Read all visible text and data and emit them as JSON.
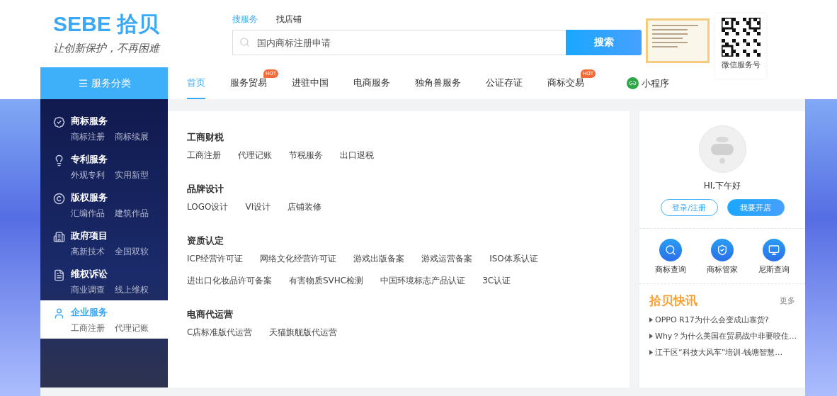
{
  "logo": {
    "brand": "SEBE 拾贝",
    "slogan": "让创新保护，不再困难"
  },
  "search": {
    "tabs": [
      {
        "label": "搜服务",
        "selected": true
      },
      {
        "label": "找店铺",
        "selected": false
      }
    ],
    "placeholder": "国内商标注册申请",
    "button": "搜索"
  },
  "qr": {
    "caption": "微信服务号"
  },
  "category_button": "服务分类",
  "nav": [
    {
      "label": "首页",
      "selected": true
    },
    {
      "label": "服务贸易",
      "selected": false,
      "badge": "HOT"
    },
    {
      "label": "进驻中国",
      "selected": false
    },
    {
      "label": "电商服务",
      "selected": false
    },
    {
      "label": "独角兽服务",
      "selected": false
    },
    {
      "label": "公证存证",
      "selected": false
    },
    {
      "label": "商标交易",
      "selected": false,
      "badge": "HOT"
    }
  ],
  "mini_program": "小程序",
  "sidebar": [
    {
      "title": "商标服务",
      "links": [
        "商标注册",
        "商标续展"
      ],
      "selected": false
    },
    {
      "title": "专利服务",
      "links": [
        "外观专利",
        "实用新型"
      ],
      "selected": false
    },
    {
      "title": "版权服务",
      "links": [
        "汇编作品",
        "建筑作品"
      ],
      "selected": false
    },
    {
      "title": "政府项目",
      "links": [
        "高新技术",
        "全国双软"
      ],
      "selected": false
    },
    {
      "title": "维权诉讼",
      "links": [
        "商业调查",
        "线上维权"
      ],
      "selected": false
    },
    {
      "title": "企业服务",
      "links": [
        "工商注册",
        "代理记账"
      ],
      "selected": true
    }
  ],
  "groups": [
    {
      "title": "工商财税",
      "links": [
        "工商注册",
        "代理记账",
        "节税服务",
        "出口退税"
      ]
    },
    {
      "title": "品牌设计",
      "links": [
        "LOGO设计",
        "VI设计",
        "店铺装修"
      ]
    },
    {
      "title": "资质认定",
      "links": [
        "ICP经营许可证",
        "网络文化经营许可证",
        "游戏出版备案",
        "游戏运营备案",
        "ISO体系认证",
        "进出口化妆品许可备案",
        "有害物质SVHC检测",
        "中国环境标志产品认证",
        "3C认证"
      ]
    },
    {
      "title": "电商代运营",
      "links": [
        "C店标准版代运营",
        "天猫旗舰版代运营"
      ]
    }
  ],
  "user": {
    "greeting": "HI,下午好",
    "login": "登录/注册",
    "open_shop": "我要开店"
  },
  "tools": [
    "商标查询",
    "商标管家",
    "尼斯查询"
  ],
  "news": {
    "title": "拾贝快讯",
    "more": "更多",
    "items": [
      "OPPO R17为什么会变成山寨货?",
      "Why？为什么美国在贸易战中非要咬住…",
      "江干区“科技大风车”培训-钱塘智慧…"
    ]
  }
}
